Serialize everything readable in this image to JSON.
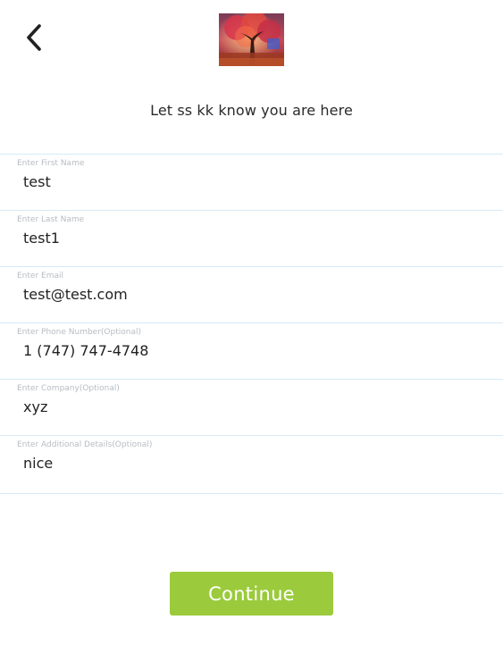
{
  "header": {
    "back_icon": "chevron-left-icon",
    "logo_image": "autumn-tree-photo"
  },
  "subtitle": "Let ss kk know you are here",
  "form": {
    "fields": [
      {
        "label": "Enter First Name",
        "value": "test"
      },
      {
        "label": "Enter Last Name",
        "value": "test1"
      },
      {
        "label": "Enter Email",
        "value": "test@test.com"
      },
      {
        "label": "Enter Phone Number(Optional)",
        "value": "1 (747) 747-4748"
      },
      {
        "label": "Enter Company(Optional)",
        "value": "xyz"
      },
      {
        "label": "Enter Additional Details(Optional)",
        "value": "nice"
      }
    ]
  },
  "continue_label": "Continue",
  "colors": {
    "accent": "#9bcb3c",
    "divider": "#d7eaf5",
    "label": "#b8bcc2"
  }
}
